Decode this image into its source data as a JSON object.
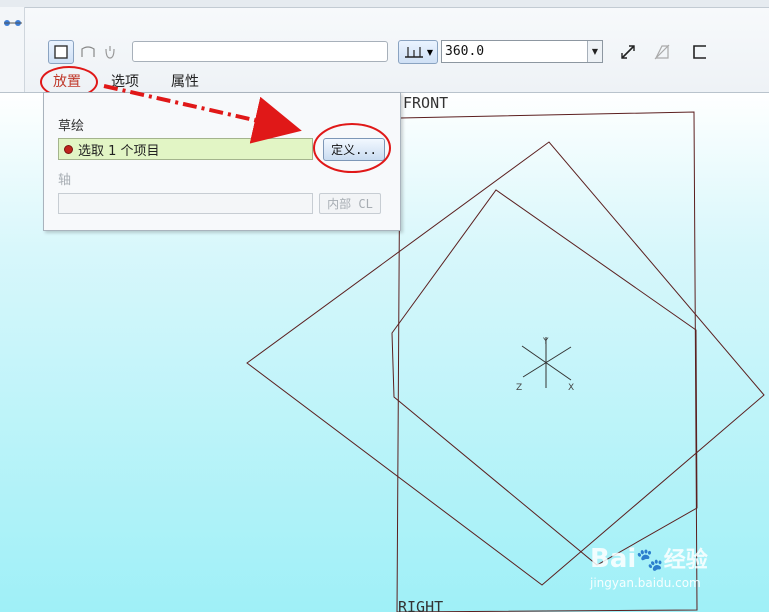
{
  "toolbar": {
    "name_value": "",
    "angle_value": "360.0",
    "tabs": [
      "放置",
      "选项",
      "属性"
    ]
  },
  "panel": {
    "sketch_label": "草绘",
    "sketch_collector": "选取 1 个项目",
    "define_button": "定义...",
    "axis_label": "轴",
    "axis_collector": "",
    "inner_button": "内部 CL"
  },
  "canvas": {
    "plane_front": "FRONT",
    "plane_right": "RIGHT",
    "csys": {
      "y": "Y",
      "z": "Z",
      "x": "X"
    }
  },
  "watermark": {
    "brand": "Bai",
    "brand_cn": "经验",
    "url": "jingyan.baidu.com"
  },
  "colors": {
    "accent_red": "#e01818",
    "canvas_top": "#ffffff",
    "canvas_bottom": "#9ff0f7",
    "collector_bg": "#e2f5c5"
  }
}
